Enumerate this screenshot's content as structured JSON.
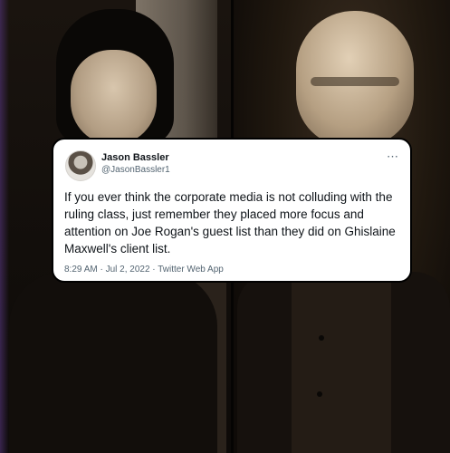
{
  "tweet": {
    "author_name": "Jason Bassler",
    "author_handle": "@JasonBassler1",
    "more_icon": "more-horizontal-icon",
    "text": "If you ever think the corporate media is not colluding with the ruling class, just remember they placed more focus and attention on Joe Rogan's guest list than they did on Ghislaine Maxwell's client list.",
    "meta": "8:29 AM · Jul 2, 2022 · Twitter Web App"
  },
  "colors": {
    "card_bg": "#ffffff",
    "card_border": "#000000",
    "text_primary": "#0f1419",
    "text_secondary": "#536471"
  }
}
